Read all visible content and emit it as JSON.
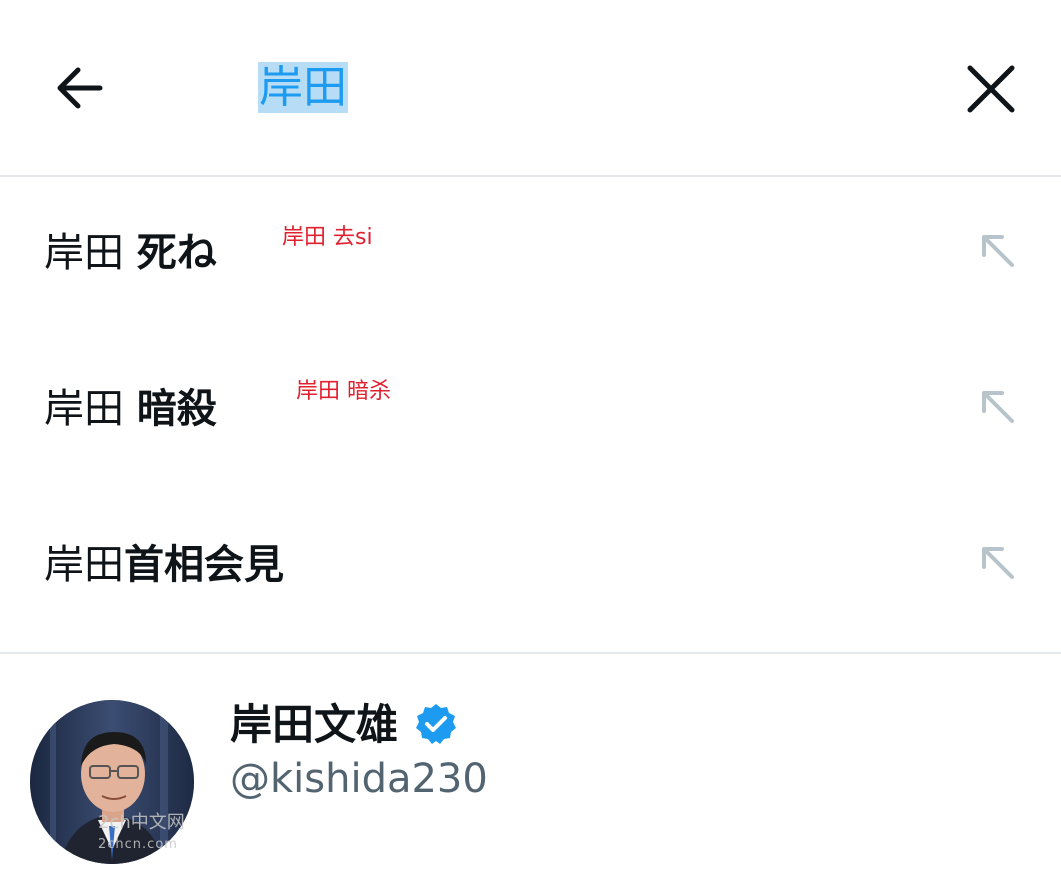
{
  "search": {
    "query": "岸田",
    "back_icon": "arrow-left-icon",
    "clear_icon": "close-icon"
  },
  "suggestions": [
    {
      "base": "岸田 ",
      "bold": "死ね",
      "annotation": "岸田 去si",
      "icon": "arrow-up-left-icon"
    },
    {
      "base": "岸田 ",
      "bold": "暗殺",
      "annotation": "岸田 暗杀",
      "icon": "arrow-up-left-icon"
    },
    {
      "base": "岸田",
      "bold": "首相会見",
      "annotation": "",
      "icon": "arrow-up-left-icon"
    }
  ],
  "user": {
    "name": "岸田文雄",
    "handle": "@kishida230",
    "verified_icon": "verified-badge-icon"
  },
  "watermark": {
    "text": "2ch中文网",
    "sub": "2chcn.com"
  },
  "colors": {
    "accent": "#1d9bf0",
    "selection": "#b7dcf6",
    "annotation": "#e0202f",
    "secondary_text": "#536471",
    "arrow_icon": "#b8c4cc",
    "divider": "#e6e9ec"
  }
}
